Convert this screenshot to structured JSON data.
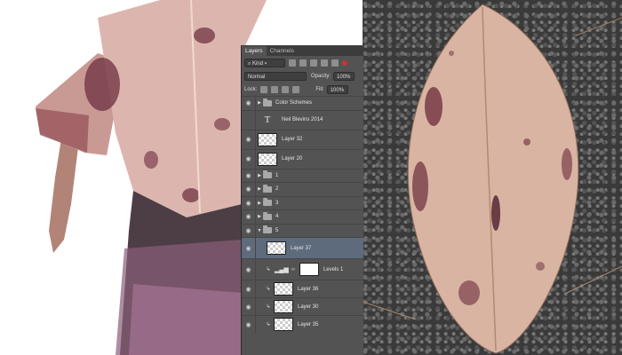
{
  "panel": {
    "tabs": [
      "Layers",
      "Channels"
    ],
    "filter_kind": "Kind",
    "blend_mode": "Normal",
    "opacity_label": "Opacity:",
    "opacity_value": "100%",
    "lock_label": "Lock:",
    "fill_label": "Fill:",
    "fill_value": "100%"
  },
  "layers": [
    {
      "name": "Color Schemes",
      "kind": "group",
      "visible": true
    },
    {
      "name": "Neil Blevins 2014",
      "kind": "text",
      "visible": false
    },
    {
      "name": "Layer 32",
      "kind": "pixel",
      "visible": true
    },
    {
      "name": "Layer 20",
      "kind": "pixel",
      "visible": true
    },
    {
      "name": "1",
      "kind": "group",
      "visible": true
    },
    {
      "name": "2",
      "kind": "group",
      "visible": true
    },
    {
      "name": "3",
      "kind": "group",
      "visible": true
    },
    {
      "name": "4",
      "kind": "group",
      "visible": true
    },
    {
      "name": "5",
      "kind": "group",
      "visible": true,
      "expanded": true
    },
    {
      "name": "Layer 37",
      "kind": "pixel",
      "visible": true,
      "selected": true
    },
    {
      "name": "Levels 1",
      "kind": "adjustment",
      "visible": true
    },
    {
      "name": "Layer 36",
      "kind": "pixel",
      "visible": true
    },
    {
      "name": "Layer 30",
      "kind": "pixel",
      "visible": true
    },
    {
      "name": "Layer 35",
      "kind": "pixel",
      "visible": true
    }
  ],
  "colors": {
    "panel_bg": "#535353",
    "selected_row": "#5d6b7c",
    "leaf_main": "#d9b4a3",
    "leaf_spots": "#6a2c3a"
  }
}
